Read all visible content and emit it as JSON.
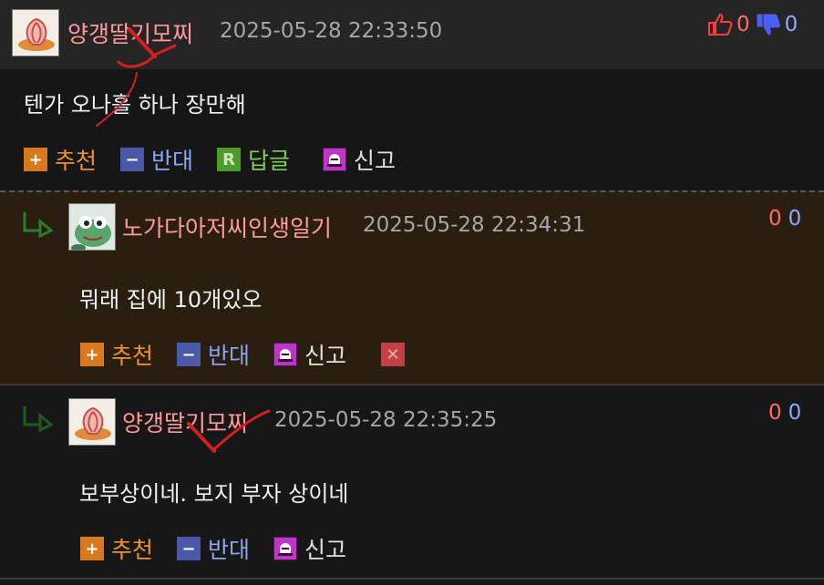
{
  "comments": [
    {
      "nickname": "양갱딸기모찌",
      "datetime": "2025-05-28 22:33:50",
      "upvotes": "0",
      "downvotes": "0",
      "content": "텐가 오나홀 하나 장만해",
      "actions": {
        "recommend": "추천",
        "oppose": "반대",
        "reply": "답글",
        "report": "신고"
      }
    },
    {
      "nickname": "노가다아저씨인생일기",
      "datetime": "2025-05-28 22:34:31",
      "upvotes": "0",
      "downvotes": "0",
      "content": "뭐래 집에 10개있오",
      "actions": {
        "recommend": "추천",
        "oppose": "반대",
        "report": "신고"
      }
    },
    {
      "nickname": "양갱딸기모찌",
      "datetime": "2025-05-28 22:35:25",
      "upvotes": "0",
      "downvotes": "0",
      "content": "보부상이네. 보지 부자 상이네",
      "actions": {
        "recommend": "추천",
        "oppose": "반대",
        "report": "신고"
      }
    }
  ],
  "icons": {
    "recommend": "plus-icon",
    "oppose": "minus-icon",
    "reply": "reply-r-icon",
    "report": "siren-icon",
    "delete": "close-icon",
    "thumb_up": "thumbs-up-icon",
    "thumb_down": "thumbs-down-icon"
  },
  "colors": {
    "nickname": "#ff9a98",
    "recommend": "#f0902e",
    "oppose": "#8aa6f0",
    "reply": "#7ecf55",
    "upvote": "#ff6b66",
    "downvote": "#8da8ff",
    "reply_block_bg": "#2a1e10"
  }
}
